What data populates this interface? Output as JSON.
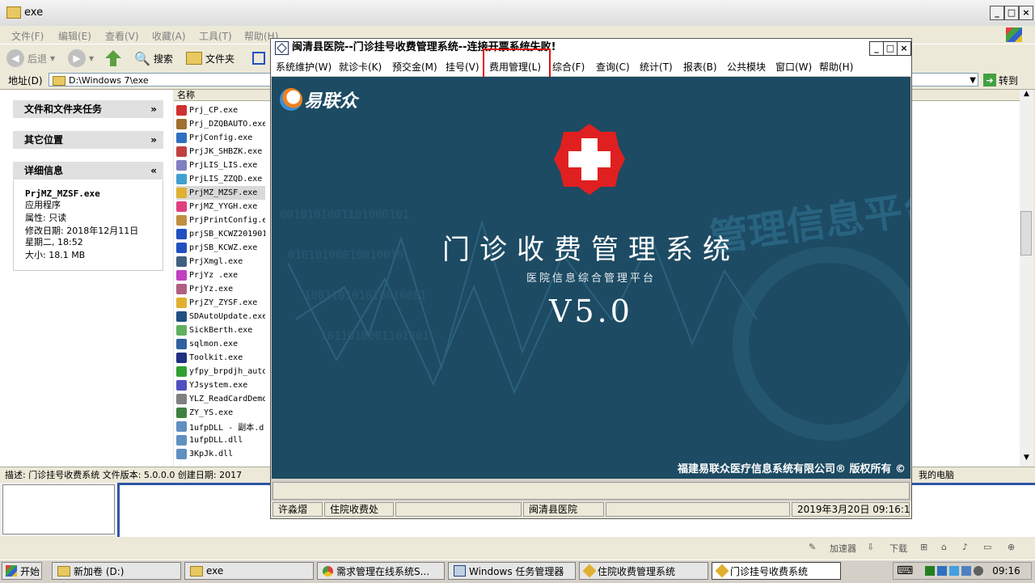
{
  "explorer": {
    "title": "exe",
    "menu": [
      "文件(F)",
      "编辑(E)",
      "查看(V)",
      "收藏(A)",
      "工具(T)",
      "帮助(H)"
    ],
    "toolbar": {
      "back": "后退",
      "search": "搜索",
      "folders": "文件夹"
    },
    "address_label": "地址(D)",
    "address_value": "D:\\Windows 7\\exe",
    "goto_label": "转到",
    "tasks": {
      "file_tasks": "文件和文件夹任务",
      "other_places": "其它位置",
      "details": "详细信息"
    },
    "details": {
      "name": "PrjMZ_MZSF.exe",
      "type": "应用程序",
      "attr": "属性: 只读",
      "modified": "修改日期: 2018年12月11日",
      "modified2": "星期二, 18:52",
      "size": "大小: 18.1 MB"
    },
    "column_name": "名称",
    "files": [
      "Prj_CP.exe",
      "Prj_DZQBAUTO.exe",
      "PrjConfig.exe",
      "PrjJK_SHBZK.exe",
      "PrjLIS_LIS.exe",
      "PrjLIS_ZZQD.exe",
      "PrjMZ_MZSF.exe",
      "PrjMZ_YYGH.exe",
      "PrjPrintConfig.exe",
      "prjSB_KCWZ201901",
      "prjSB_KCWZ.exe",
      "PrjXmgl.exe",
      "PrjYz .exe",
      "PrjYz.exe",
      "PrjZY_ZYSF.exe",
      "SDAutoUpdate.exe",
      "SickBerth.exe",
      "sqlmon.exe",
      "Toolkit.exe",
      "yfpy_brpdjh_auto",
      "YJsystem.exe",
      "YLZ_ReadCardDemo",
      "ZY_YS.exe",
      "1ufpDLL - 副本.d",
      "1ufpDLL.dll",
      "3KpJk.dll"
    ],
    "file_icon_colors": [
      "#d03030",
      "#a07030",
      "#3070c0",
      "#c04040",
      "#8080c0",
      "#40a0d0",
      "#e0b030",
      "#e04080",
      "#c09040",
      "#2050c0",
      "#2050c0",
      "#406080",
      "#c040c0",
      "#b06080",
      "#e0b030",
      "#205080",
      "#60b060",
      "#3060a0",
      "#203080",
      "#30a030",
      "#5050c0",
      "#808080",
      "#408040",
      "#6090c0",
      "#6090c0",
      "#6090c0"
    ],
    "selected_file": 6,
    "status_text": "描述: 门诊挂号收费系统 文件版本: 5.0.0.0 创建日期: 2017",
    "status_right": "我的电脑"
  },
  "tray_upper": [
    "加速器",
    "下载"
  ],
  "taskbar": {
    "start": "开始",
    "items": [
      "新加卷 (D:)",
      "exe",
      "需求管理在线系统S...",
      "Windows 任务管理器",
      "住院收费管理系统",
      "门诊挂号收费系统"
    ],
    "time": "09:16"
  },
  "app": {
    "title": "闽清县医院--门诊挂号收费管理系统--连接开票系统失败!",
    "menu": [
      "系统维护(W)",
      "就诊卡(K)",
      "预交金(M)",
      "挂号(V)",
      "费用管理(L)",
      "综合(F)",
      "查询(C)",
      "统计(T)",
      "报表(B)",
      "公共模块",
      "窗口(W)",
      "帮助(H)"
    ],
    "splash": {
      "logo": "易联众",
      "heading": "门诊收费管理系统",
      "subheading": "医院信息综合管理平台",
      "version": "V5.0",
      "watermark": "管理信息平台",
      "copyright": "福建易联众医疗信息系统有限公司® 版权所有 ©"
    },
    "status": [
      "许淼熠",
      "住院收费处",
      "闽清县医院",
      "2019年3月20日 09:16:1"
    ]
  },
  "colors": {
    "splash_bg": "#1d4b63",
    "highlight": "#e01010",
    "cross_red": "#e02020"
  }
}
